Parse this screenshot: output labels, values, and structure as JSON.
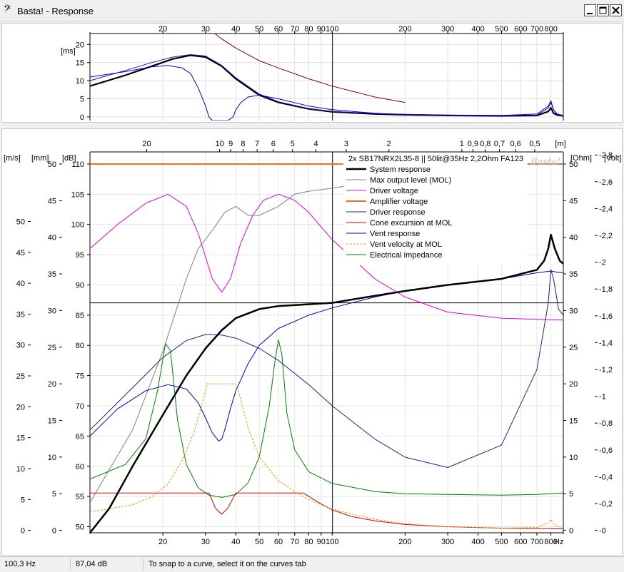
{
  "window": {
    "title": "Basta! - Response",
    "app_icon": "bass-clef-icon",
    "buttons": [
      "minimize-icon",
      "maximize-icon",
      "close-icon"
    ]
  },
  "status_bar": {
    "frequency": "100,3 Hz",
    "level": "87,04 dB",
    "hint": "To snap to a curve, select it on the curves tab"
  },
  "chart_data": [
    {
      "type": "line",
      "name_panel": "group delay",
      "ylabel": "[ms]",
      "x_scale": "log",
      "xlim": [
        10,
        900
      ],
      "ylim": [
        -1,
        23
      ],
      "yticks": [
        0,
        5,
        10,
        15,
        20
      ],
      "xtick_labels_top": [
        "20",
        "30",
        "40",
        "50",
        "60",
        "70",
        "80",
        "90",
        "100",
        "200",
        "300",
        "400",
        "500",
        "600",
        "700",
        "800"
      ],
      "xtick_values": [
        20,
        30,
        40,
        50,
        60,
        70,
        80,
        90,
        100,
        200,
        300,
        400,
        500,
        600,
        700,
        800
      ],
      "cursor_x": 100.3,
      "series": [
        {
          "color": "#000000",
          "width": 2.2,
          "x": [
            10,
            14,
            18,
            22,
            26,
            30,
            35,
            40,
            50,
            60,
            80,
            100,
            150,
            200,
            300,
            500,
            700,
            780,
            800,
            820,
            850,
            900
          ],
          "y": [
            8.5,
            11.5,
            14.0,
            16.0,
            17.0,
            16.5,
            14.0,
            10.5,
            6.0,
            4.0,
            2.2,
            1.4,
            0.8,
            0.6,
            0.4,
            0.3,
            0.4,
            1.5,
            2.5,
            1.0,
            0.5,
            0.3
          ]
        },
        {
          "color": "#1a1aa0",
          "width": 1,
          "x": [
            10,
            14,
            18,
            22,
            26,
            30,
            35,
            40,
            50,
            60,
            80,
            100,
            150,
            200,
            300,
            500,
            700,
            780,
            800,
            820,
            850,
            900
          ],
          "y": [
            10.0,
            12.8,
            15.0,
            16.5,
            17.2,
            16.8,
            14.2,
            10.8,
            6.3,
            4.2,
            2.3,
            1.5,
            0.9,
            0.7,
            0.5,
            0.4,
            0.8,
            3.0,
            4.5,
            2.0,
            0.8,
            0.4
          ]
        },
        {
          "color": "#0000cc",
          "width": 1,
          "x": [
            10,
            14,
            18,
            21,
            24,
            26,
            28,
            30,
            31,
            32,
            37,
            39,
            40,
            42,
            45,
            50,
            60,
            80,
            100,
            150,
            200,
            300,
            500,
            700,
            780,
            800,
            820,
            850,
            900
          ],
          "y": [
            11.0,
            12.5,
            13.8,
            14.2,
            13.5,
            12.0,
            8.0,
            3.0,
            0.0,
            -1.0,
            -1.0,
            0.0,
            2.0,
            4.0,
            5.5,
            6.0,
            5.0,
            3.0,
            2.0,
            1.0,
            0.6,
            0.4,
            0.3,
            0.5,
            2.5,
            4.0,
            2.0,
            0.5,
            0.3
          ]
        },
        {
          "color": "#800000",
          "width": 1,
          "x": [
            10,
            20,
            27,
            30,
            35,
            40,
            50,
            60,
            80,
            100,
            150,
            200
          ],
          "y": [
            25,
            25,
            25,
            25,
            21.5,
            19.0,
            15.5,
            13.5,
            10.5,
            8.5,
            5.5,
            4.0
          ]
        }
      ]
    },
    {
      "type": "line",
      "name_panel": "response",
      "x_scale": "log",
      "xlim": [
        10,
        900
      ],
      "axis_units": {
        "left_outer": "[m/s]",
        "left_middle": "[mm]",
        "left_inner": "[dB]",
        "right_inner": "[Ohm]",
        "right_outer": "[Volt]",
        "top": "[m]",
        "bottom_unit": "Hz"
      },
      "xtick_labels_bottom": [
        "20",
        "30",
        "40",
        "50",
        "60",
        "70",
        "80",
        "90",
        "100",
        "200",
        "300",
        "400",
        "500",
        "600",
        "700",
        "800"
      ],
      "xtick_values": [
        20,
        30,
        40,
        50,
        60,
        70,
        80,
        90,
        100,
        200,
        300,
        400,
        500,
        600,
        700,
        800
      ],
      "top_wavelength_labels": [
        "20",
        "10",
        "9",
        "8",
        "7",
        "6",
        "5",
        "4",
        "3",
        "2",
        "1",
        "0,9",
        "0,8",
        "0,7",
        "0,6",
        "0,5"
      ],
      "top_wavelength_values": [
        20,
        10,
        9,
        8,
        7,
        6,
        5,
        4,
        3,
        2,
        1,
        0.9,
        0.8,
        0.7,
        0.6,
        0.5
      ],
      "db_ticks": [
        "50",
        "55",
        "60",
        "65",
        "70",
        "75",
        "80",
        "85",
        "90",
        "95",
        "100",
        "105",
        "110"
      ],
      "db_values": [
        50,
        55,
        60,
        65,
        70,
        75,
        80,
        85,
        90,
        95,
        100,
        105,
        110
      ],
      "db_range": [
        49,
        112
      ],
      "mm_ticks": [
        "0",
        "5",
        "10",
        "15",
        "20",
        "25",
        "30",
        "35",
        "40",
        "45",
        "50"
      ],
      "mm_values": [
        0,
        5,
        10,
        15,
        20,
        25,
        30,
        35,
        40,
        45,
        50
      ],
      "mm_range": [
        -1,
        52
      ],
      "ms_ticks": [
        "0",
        "5",
        "10",
        "15",
        "20",
        "25",
        "30",
        "35",
        "40",
        "45",
        "50"
      ],
      "ms_values": [
        0,
        5,
        10,
        15,
        20,
        25,
        30,
        35,
        40,
        45,
        50
      ],
      "ms_range": [
        0,
        50
      ],
      "ohm_ticks": [
        "0",
        "5",
        "10",
        "15",
        "20",
        "25",
        "30",
        "35",
        "40",
        "45",
        "50"
      ],
      "ohm_values": [
        0,
        5,
        10,
        15,
        20,
        25,
        30,
        35,
        40,
        45,
        50
      ],
      "volt_ticks": [
        "-0",
        "-0,2",
        "-0,4",
        "-0,6",
        "-0,8",
        "-1",
        "-1,2",
        "-1,4",
        "-1,6",
        "-1,8",
        "-2",
        "-2,2",
        "-2,4",
        "-2,6",
        "-2,8"
      ],
      "volt_values": [
        0,
        0.2,
        0.4,
        0.6,
        0.8,
        1.0,
        1.2,
        1.4,
        1.6,
        1.8,
        2.0,
        2.2,
        2.4,
        2.6,
        2.8
      ],
      "volt_range": [
        0,
        2.8
      ],
      "cursor": {
        "x": 100.3,
        "db": 87.04
      },
      "legend": {
        "title": "2x SB17NRX2L35-8 || 50lit@35Hz 2,2Ohm FA123",
        "placement": "top-right",
        "entries": [
          {
            "name": "System response",
            "color": "#000000",
            "dash": false,
            "width": 2.5
          },
          {
            "name": "Max output level (MOL)",
            "color": "#808080",
            "dash": false,
            "width": 1
          },
          {
            "name": "Driver voltage",
            "color": "#e000e0",
            "dash": false,
            "width": 1
          },
          {
            "name": "Amplifier voltage",
            "color": "#f07020",
            "dash": false,
            "width": 2
          },
          {
            "name": "Driver response",
            "color": "#202090",
            "dash": false,
            "width": 1
          },
          {
            "name": "Cone excursion at MOL",
            "color": "#cc0000",
            "dash": false,
            "width": 1
          },
          {
            "name": "Vent response",
            "color": "#0000cc",
            "dash": false,
            "width": 1
          },
          {
            "name": "Vent velocity at MOL",
            "color": "#e0a000",
            "dash": true,
            "width": 1
          },
          {
            "name": "Electrical impedance",
            "color": "#008000",
            "dash": false,
            "width": 1
          }
        ]
      },
      "watermark": "Basta!",
      "series": [
        {
          "name": "System response",
          "axis": "db",
          "color": "#000000",
          "width": 2.5,
          "x": [
            10,
            12,
            15,
            20,
            25,
            30,
            35,
            40,
            50,
            60,
            80,
            100,
            150,
            200,
            300,
            500,
            700,
            750,
            780,
            800,
            830,
            870,
            900
          ],
          "y": [
            49,
            53,
            60,
            68.5,
            75,
            79.5,
            82.5,
            84.5,
            86,
            86.5,
            86.8,
            87.04,
            88.2,
            89,
            90,
            91,
            92.5,
            94,
            96,
            98.3,
            96,
            94,
            93.5
          ]
        },
        {
          "name": "Max output level (MOL)",
          "axis": "db",
          "color": "#808080",
          "width": 1,
          "x": [
            10,
            15,
            20,
            25,
            28,
            32,
            36,
            40,
            45,
            50,
            60,
            70,
            80,
            100,
            120
          ],
          "y": [
            54,
            66,
            79,
            91,
            96,
            99,
            102,
            103,
            101.5,
            101.5,
            103,
            105,
            105.5,
            106,
            106.5
          ]
        },
        {
          "name": "Driver voltage",
          "axis": "db",
          "color": "#e000e0",
          "width": 1,
          "x": [
            10,
            13,
            17,
            21,
            25,
            28,
            32,
            35,
            38,
            42,
            47,
            52,
            60,
            70,
            80,
            100,
            150,
            200,
            300,
            500,
            700,
            900
          ],
          "y": [
            96,
            100,
            103.5,
            105,
            103,
            98.5,
            91,
            88.8,
            91,
            97,
            101.5,
            104,
            105,
            104,
            102,
            97.5,
            91,
            88,
            85.5,
            84.5,
            84.3,
            84.2
          ]
        },
        {
          "name": "Amplifier voltage",
          "axis": "db",
          "color": "#f07020",
          "width": 2,
          "x": [
            10,
            900
          ],
          "y": [
            110,
            110
          ]
        },
        {
          "name": "Driver response",
          "axis": "db",
          "color": "#202090",
          "width": 1,
          "x": [
            10,
            15,
            20,
            25,
            30,
            35,
            40,
            50,
            60,
            80,
            100,
            150,
            200,
            300,
            500,
            700,
            780,
            800,
            820,
            860,
            900
          ],
          "y": [
            66,
            73,
            78,
            80.8,
            81.8,
            81.7,
            81.2,
            79.5,
            77.5,
            73.5,
            70,
            64.5,
            61.5,
            59.8,
            63.5,
            76,
            87,
            92.5,
            91,
            86,
            85
          ]
        },
        {
          "name": "Cone excursion at MOL",
          "axis": "mm",
          "color": "#cc0000",
          "width": 1,
          "x": [
            10,
            20,
            31,
            33,
            35,
            37,
            40,
            50,
            60,
            76,
            90,
            100,
            120,
            150,
            200,
            300,
            500,
            900
          ],
          "y": [
            5.1,
            5.1,
            5.1,
            3.0,
            2.2,
            3.0,
            5.1,
            5.1,
            5.1,
            5.1,
            3.6,
            2.8,
            1.9,
            1.3,
            0.8,
            0.5,
            0.3,
            0.2
          ]
        },
        {
          "name": "Vent response",
          "axis": "db",
          "color": "#0000cc",
          "width": 1,
          "x": [
            10,
            13,
            17,
            21,
            25,
            28,
            30,
            32,
            34,
            35,
            36,
            38,
            40,
            45,
            50,
            60,
            80,
            100,
            150,
            200,
            300,
            500,
            700,
            800,
            850,
            900
          ],
          "y": [
            65,
            69.5,
            72.5,
            73.5,
            72.8,
            70.5,
            68,
            65.5,
            64.2,
            64.5,
            66,
            69.5,
            72.5,
            77,
            80,
            82.8,
            85,
            86.2,
            88,
            89,
            90,
            91,
            92,
            92.3,
            92.1,
            92
          ]
        },
        {
          "name": "Vent velocity at MOL",
          "axis": "ms",
          "color": "#e0a000",
          "width": 1,
          "dash": true,
          "x": [
            10,
            15,
            18,
            21,
            24,
            27,
            30,
            30.5,
            40,
            41,
            45,
            50,
            60,
            70,
            80,
            100,
            150,
            200,
            300,
            500,
            700,
            780,
            800,
            830,
            900
          ],
          "y": [
            2.5,
            3.5,
            4.6,
            6.3,
            9.5,
            13.5,
            19,
            20,
            20,
            19,
            14,
            10,
            6.8,
            5.3,
            4.2,
            2.9,
            1.5,
            0.9,
            0.5,
            0.3,
            0.4,
            1.0,
            1.5,
            0.7,
            0.3
          ]
        },
        {
          "name": "Electrical impedance",
          "axis": "ohm",
          "color": "#008000",
          "width": 1,
          "x": [
            10,
            14,
            17,
            19,
            20.5,
            21.5,
            23,
            25,
            28,
            31,
            35,
            40,
            45,
            50,
            55,
            58,
            60,
            62,
            65,
            70,
            80,
            100,
            150,
            200,
            300,
            500,
            700,
            800,
            900
          ],
          "y": [
            7,
            9,
            12.5,
            19,
            25.5,
            24.5,
            15,
            9,
            5.8,
            4.8,
            4.5,
            4.9,
            6.5,
            10,
            17,
            23,
            26,
            24,
            16,
            11,
            8,
            6.4,
            5.3,
            5.0,
            4.9,
            4.8,
            4.9,
            5.0,
            5.1
          ]
        }
      ]
    }
  ]
}
